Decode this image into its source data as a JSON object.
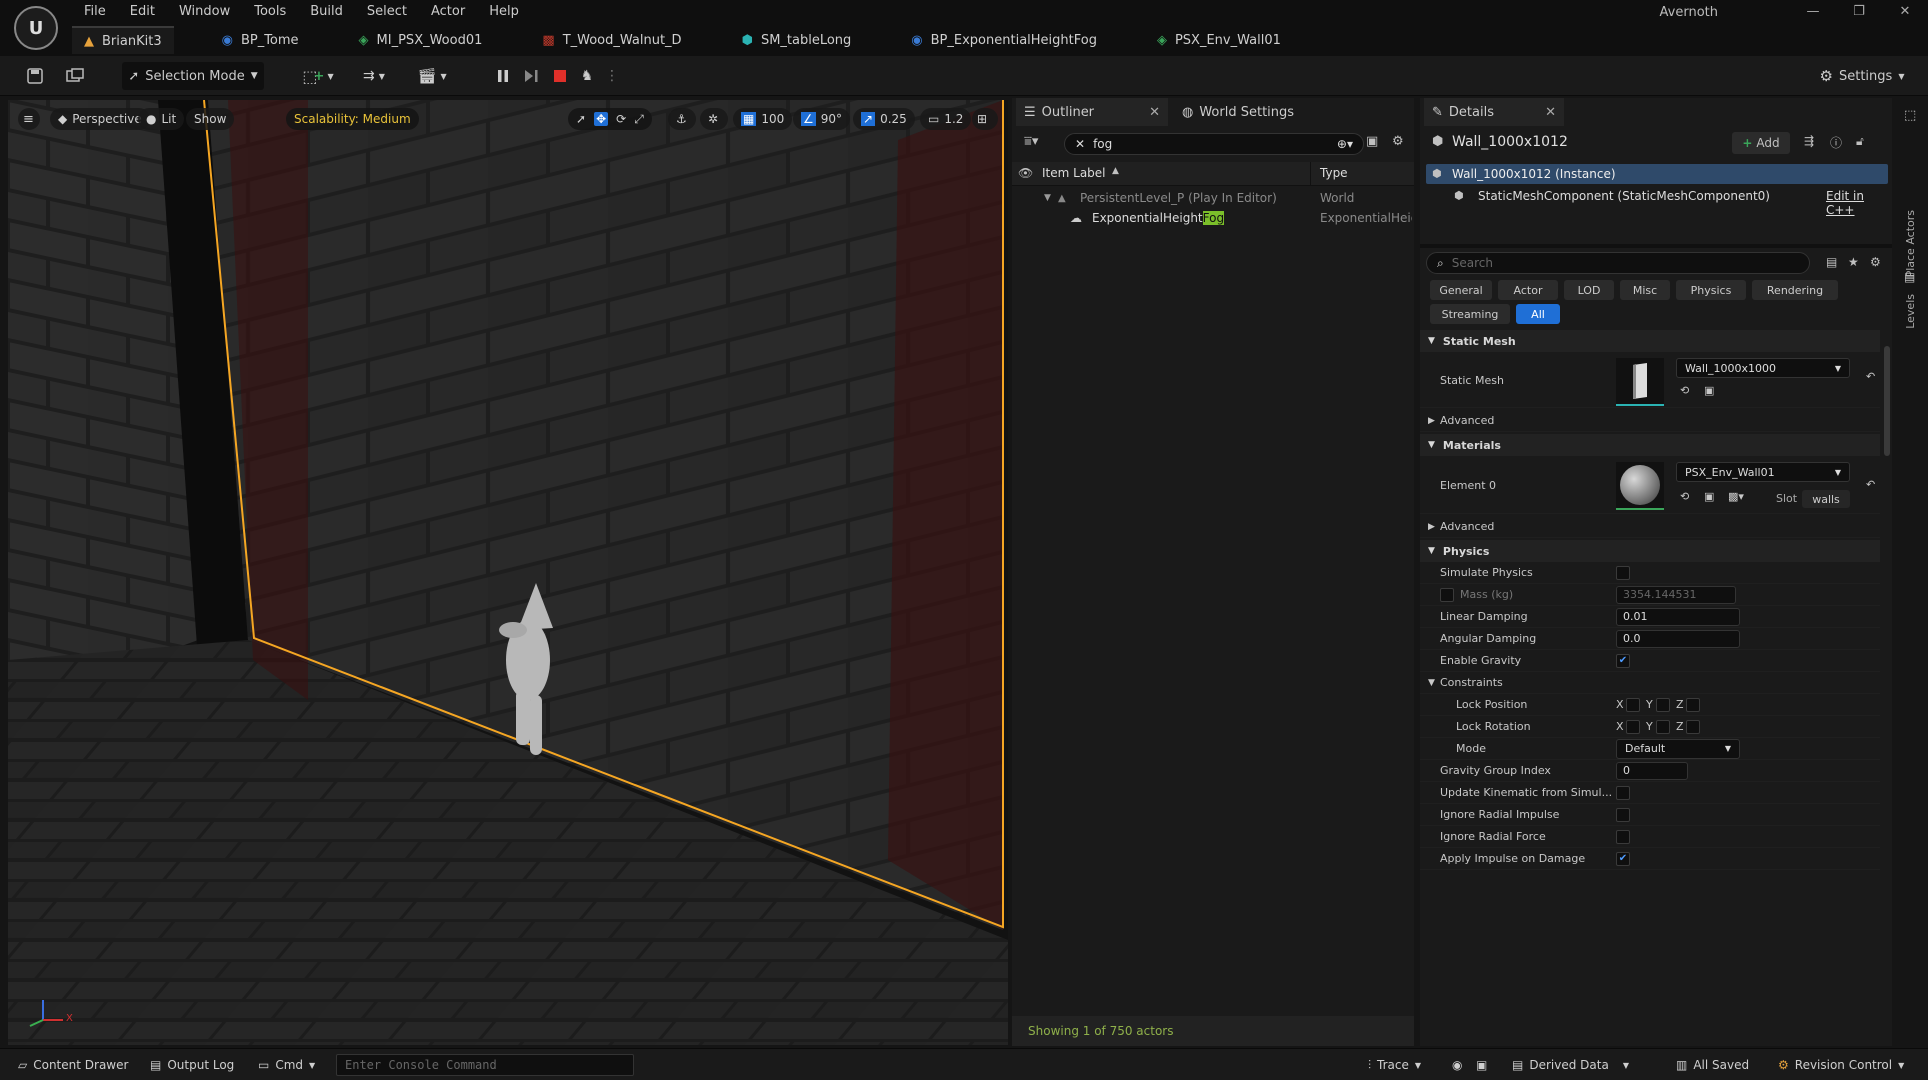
{
  "app": {
    "logo": "U",
    "user": "Avernoth"
  },
  "menu": [
    "File",
    "Edit",
    "Window",
    "Tools",
    "Build",
    "Select",
    "Actor",
    "Help"
  ],
  "window_controls": {
    "minimize": "—",
    "maximize": "❐",
    "close": "✕"
  },
  "tabs": [
    {
      "label": "BrianKit3",
      "icon": "level-icon",
      "color": "#e6a23c",
      "active": true
    },
    {
      "label": "BP_Tome",
      "icon": "blueprint-icon",
      "color": "#3a7bd5"
    },
    {
      "label": "MI_PSX_Wood01",
      "icon": "material-instance-icon",
      "color": "#3aa55a"
    },
    {
      "label": "T_Wood_Walnut_D",
      "icon": "texture-icon",
      "color": "#c0392b"
    },
    {
      "label": "SM_tableLong",
      "icon": "static-mesh-icon",
      "color": "#2bb3b3"
    },
    {
      "label": "BP_ExponentialHeightFog",
      "icon": "blueprint-icon",
      "color": "#3a7bd5"
    },
    {
      "label": "PSX_Env_Wall01",
      "icon": "material-icon",
      "color": "#3aa55a"
    }
  ],
  "toolbar": {
    "selection_mode": "Selection Mode",
    "settings": "Settings"
  },
  "viewport": {
    "perspective": "Perspective",
    "lit": "Lit",
    "show": "Show",
    "scalability": "Scalability: Medium",
    "grid_snap": "100",
    "rotation_snap": "90°",
    "scale_snap": "0.25",
    "camera_speed": "1.2",
    "axis_x": "X"
  },
  "outliner": {
    "tab_label": "Outliner",
    "world_settings_label": "World Settings",
    "search_value": "fog",
    "col_item_label": "Item Label",
    "col_type": "Type",
    "rows": [
      {
        "label": "PersistentLevel_P (Play In Editor)",
        "type": "World"
      },
      {
        "label_prefix": "ExponentialHeight",
        "label_highlight": "Fog",
        "type": "ExponentialHeigh"
      }
    ],
    "status": "Showing 1 of 750 actors"
  },
  "details": {
    "tab_label": "Details",
    "object_name": "Wall_1000x1012",
    "add_button": "Add",
    "instance_row": "Wall_1000x1012 (Instance)",
    "component_row": "StaticMeshComponent (StaticMeshComponent0)",
    "edit_cpp": "Edit in C++",
    "search_placeholder": "Search",
    "filters": [
      "General",
      "Actor",
      "LOD",
      "Misc",
      "Physics",
      "Rendering",
      "Streaming",
      "All"
    ],
    "active_filter": "All",
    "static_mesh": {
      "category": "Static Mesh",
      "label": "Static Mesh",
      "value": "Wall_1000x1000",
      "advanced": "Advanced"
    },
    "materials": {
      "category": "Materials",
      "label": "Element 0",
      "value": "PSX_Env_Wall01",
      "slot_label": "Slot",
      "slot_value": "walls",
      "advanced": "Advanced"
    },
    "physics": {
      "category": "Physics",
      "simulate_physics": "Simulate Physics",
      "mass_label": "Mass (kg)",
      "mass_value": "3354.144531",
      "linear_damping": "Linear Damping",
      "linear_damping_value": "0.01",
      "angular_damping": "Angular Damping",
      "angular_damping_value": "0.0",
      "enable_gravity": "Enable Gravity",
      "constraints": "Constraints",
      "lock_position": "Lock Position",
      "lock_rotation": "Lock Rotation",
      "axis_x": "X",
      "axis_y": "Y",
      "axis_z": "Z",
      "mode": "Mode",
      "mode_value": "Default",
      "gravity_group_index": "Gravity Group Index",
      "gravity_group_value": "0",
      "update_kinematic": "Update Kinematic from Simul...",
      "ignore_radial_impulse": "Ignore Radial Impulse",
      "ignore_radial_force": "Ignore Radial Force",
      "apply_impulse": "Apply Impulse on Damage"
    },
    "side_tabs": [
      "Place Actors",
      "Levels"
    ]
  },
  "statusbar": {
    "content_drawer": "Content Drawer",
    "output_log": "Output Log",
    "cmd": "Cmd",
    "console_placeholder": "Enter Console Command",
    "trace": "Trace",
    "derived_data": "Derived Data",
    "all_saved": "All Saved",
    "revision_control": "Revision Control"
  },
  "colors": {
    "accent": "#1f6fd6",
    "selection_outline": "#f5a623",
    "search_highlight": "#7bbf2a",
    "check": "#1f6fd6"
  }
}
